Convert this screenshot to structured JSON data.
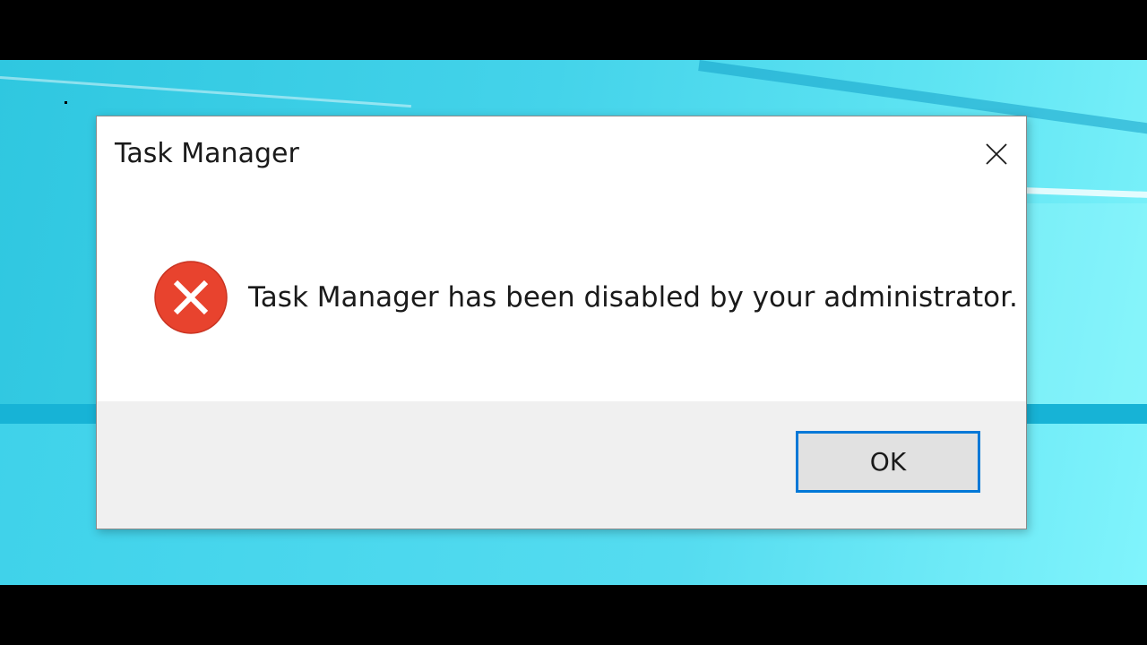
{
  "dialog": {
    "title": "Task Manager",
    "message": "Task Manager has been disabled by your administrator.",
    "ok_label": "OK",
    "icon": "error-icon"
  },
  "colors": {
    "desktop": "#44d3ea",
    "error_red": "#e8432e",
    "button_focus_border": "#0078d7",
    "footer": "#f0f0f0"
  }
}
